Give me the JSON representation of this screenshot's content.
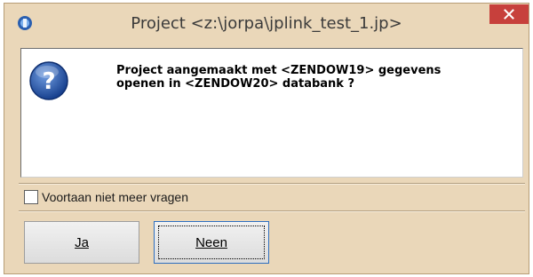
{
  "window": {
    "title": "Project <z:\\jorpa\\jplink_test_1.jp>",
    "app_icon": "app-icon",
    "close_icon": "close-icon"
  },
  "dialog": {
    "icon": "question-icon",
    "message": "Project aangemaakt met <ZENDOW19> gegevens\nopenen in <ZENDOW20> databank ?",
    "checkbox": {
      "label": "Voortaan niet meer vragen",
      "checked": false
    }
  },
  "buttons": {
    "ja_label": "Ja",
    "neen_label": "Neen"
  },
  "colors": {
    "frame": "#ead7b9",
    "close_button": "#c7403c",
    "focus_border": "#2f6fbf"
  }
}
